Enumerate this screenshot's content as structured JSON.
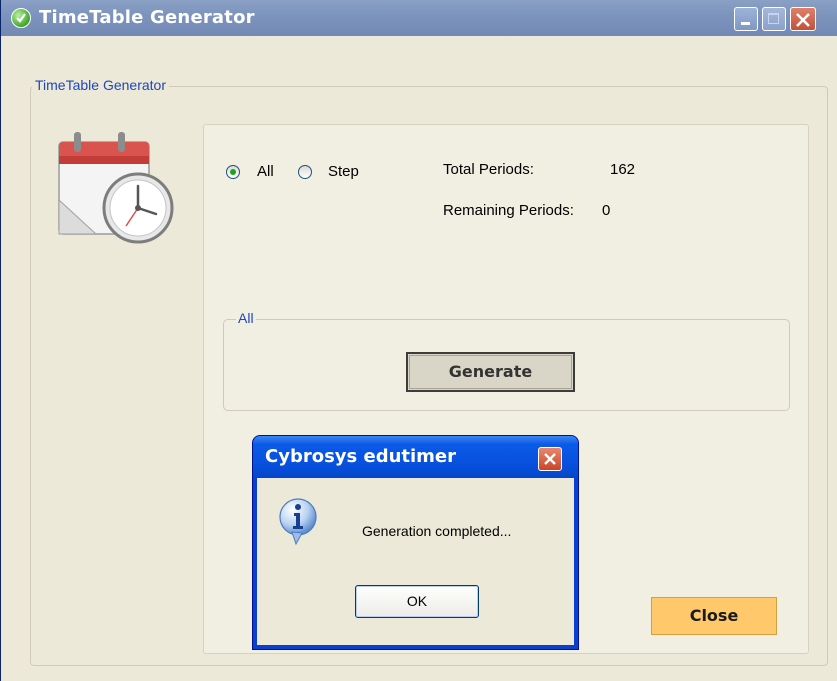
{
  "window": {
    "title": "TimeTable Generator"
  },
  "outer_group": {
    "legend": "TimeTable Generator"
  },
  "mode": {
    "options": [
      {
        "label": "All",
        "selected": true
      },
      {
        "label": "Step",
        "selected": false
      }
    ]
  },
  "stats": {
    "total_label": "Total Periods:",
    "total_value": "162",
    "remaining_label": "Remaining Periods:",
    "remaining_value": "0"
  },
  "all_group": {
    "legend": "All",
    "generate_label": "Generate"
  },
  "close_label": "Close",
  "dialog": {
    "title": "Cybrosys edutimer",
    "message": "Generation completed...",
    "ok_label": "OK"
  },
  "colors": {
    "accent_legend": "#1f47b8",
    "close_button": "#ffc86b",
    "dialog_titlebar": "#0750dc"
  }
}
